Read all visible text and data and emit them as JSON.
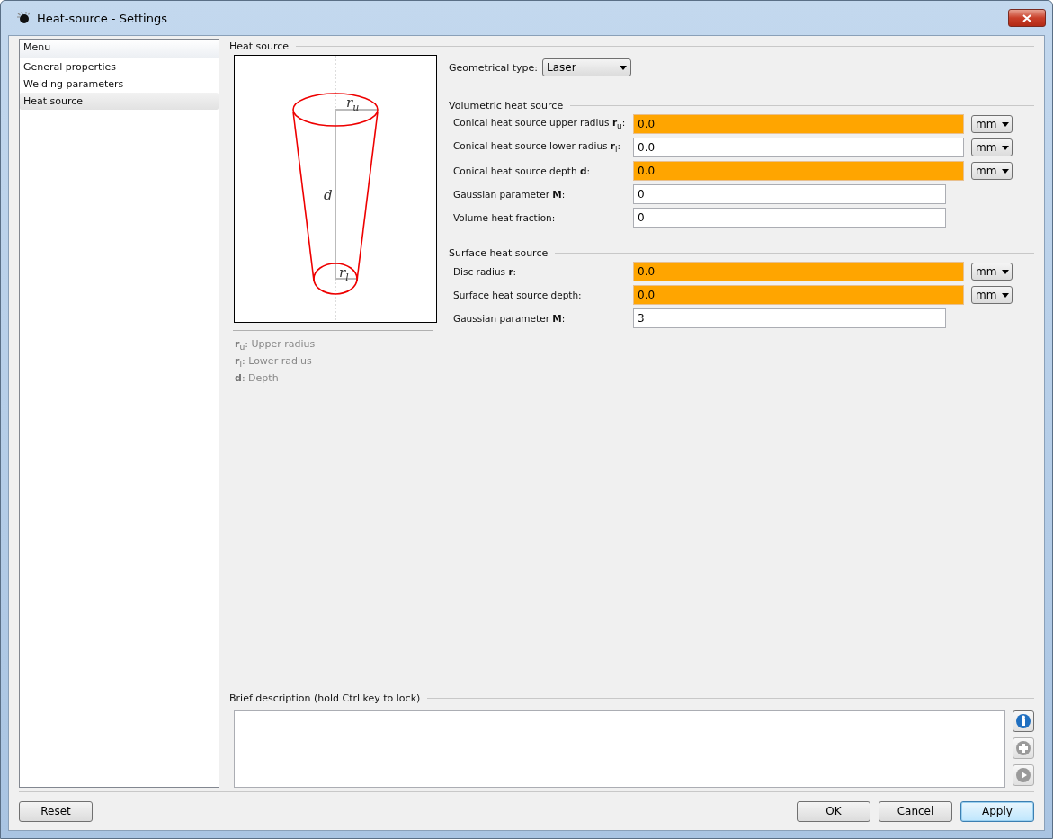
{
  "window": {
    "title": "Heat-source - Settings"
  },
  "sidebar": {
    "header": "Menu",
    "items": [
      {
        "label": "General properties",
        "selected": false
      },
      {
        "label": "Welding parameters",
        "selected": false
      },
      {
        "label": "Heat source",
        "selected": true
      }
    ]
  },
  "heat_source": {
    "title": "Heat source",
    "diagram": {
      "upper": {
        "symbol": "r",
        "sub": "u"
      },
      "depth": {
        "symbol": "d"
      },
      "lower": {
        "symbol": "r",
        "sub": "l"
      }
    },
    "legend": [
      {
        "symbol": "**r**$_{u}$:",
        "text": "Upper radius"
      },
      {
        "symbol": "**r**$_{l}$:",
        "text": "Lower radius"
      },
      {
        "symbol": "**d**:",
        "text": "Depth"
      }
    ],
    "geometrical_type": {
      "label": "Geometrical type:",
      "value": "Laser"
    },
    "sections": [
      {
        "title": "Volumetric heat source",
        "fields": [
          {
            "label": "Conical heat source upper radius **r**$_{u}$:",
            "value": "0.0",
            "highlighted": true,
            "unit": "mm"
          },
          {
            "label": "Conical heat source lower radius **r**$_{l}$:",
            "value": "0.0",
            "highlighted": false,
            "unit": "mm"
          },
          {
            "label": "Conical heat source depth **d**:",
            "value": "0.0",
            "highlighted": true,
            "unit": "mm"
          },
          {
            "label": "Gaussian parameter **M**:",
            "value": "0",
            "highlighted": false
          },
          {
            "label": "Volume heat fraction:",
            "value": "0",
            "highlighted": false
          }
        ]
      },
      {
        "title": "Surface heat source",
        "fields": [
          {
            "label": "Disc radius **r**:",
            "value": "0.0",
            "highlighted": true,
            "unit": "mm"
          },
          {
            "label": "Surface heat source depth:",
            "value": "0.0",
            "highlighted": true,
            "unit": "mm"
          },
          {
            "label": "Gaussian parameter **M**:",
            "value": "3",
            "highlighted": false
          }
        ]
      }
    ]
  },
  "description": {
    "title": "Brief description (hold Ctrl key to lock)",
    "tools": [
      {
        "kind": "info",
        "disabled": false
      },
      {
        "kind": "add",
        "disabled": true
      },
      {
        "kind": "play",
        "disabled": true
      }
    ]
  },
  "buttons": {
    "left": [
      "Reset"
    ],
    "right": [
      {
        "label": "OK",
        "default": false
      },
      {
        "label": "Cancel",
        "default": false
      },
      {
        "label": "Apply",
        "default": true
      }
    ]
  }
}
